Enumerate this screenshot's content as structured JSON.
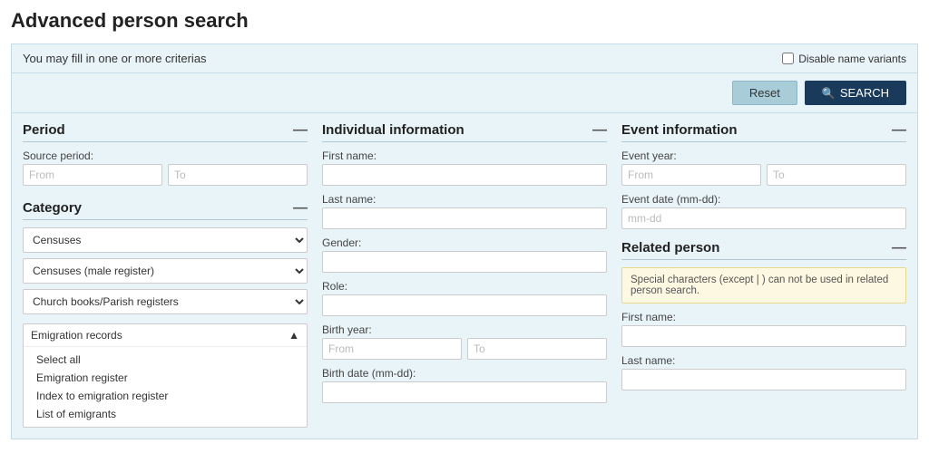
{
  "page": {
    "title": "Advanced person search"
  },
  "topbar": {
    "hint": "You may fill in one or more criterias",
    "disable_label": "Disable name variants"
  },
  "toolbar": {
    "reset_label": "Reset",
    "search_label": "SEARCH"
  },
  "period": {
    "title": "Period",
    "source_period_label": "Source period:",
    "from_placeholder": "From",
    "to_placeholder": "To"
  },
  "individual": {
    "title": "Individual information",
    "first_name_label": "First name:",
    "last_name_label": "Last name:",
    "gender_label": "Gender:",
    "role_label": "Role:",
    "birth_year_label": "Birth year:",
    "birth_year_from": "From",
    "birth_year_to": "To",
    "birth_date_label": "Birth date (mm-dd):"
  },
  "event": {
    "title": "Event information",
    "event_year_label": "Event year:",
    "event_year_from": "From",
    "event_year_to": "To",
    "event_date_label": "Event date (mm-dd):",
    "event_date_placeholder": "mm-dd"
  },
  "category": {
    "title": "Category",
    "dropdowns": [
      {
        "value": "Censuses"
      },
      {
        "value": "Censuses (male register)"
      },
      {
        "value": "Church books/Parish registers"
      }
    ],
    "emigration_records_label": "Emigration records",
    "items": [
      {
        "label": "Select all",
        "id": "select-all"
      },
      {
        "label": "Emigration register",
        "id": "emigration-register"
      },
      {
        "label": "Index to emigration register",
        "id": "index-emigration"
      },
      {
        "label": "List of emigrants",
        "id": "list-emigrants"
      }
    ]
  },
  "related_person": {
    "title": "Related person",
    "notice": "Special characters (except | ) can not be used in related person search.",
    "first_name_label": "First name:",
    "last_name_label": "Last name:"
  }
}
